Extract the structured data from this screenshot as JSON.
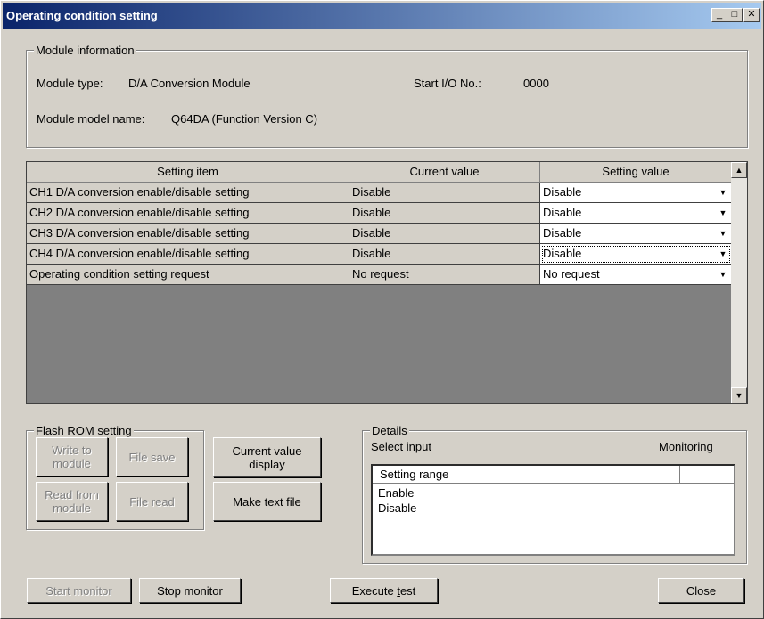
{
  "window": {
    "title": "Operating condition setting",
    "minimize": "_",
    "maximize": "□",
    "close": "✕"
  },
  "module_info": {
    "legend": "Module information",
    "type_label": "Module type:",
    "type_value": "D/A Conversion Module",
    "io_label": "Start I/O No.:",
    "io_value": "0000",
    "model_label": "Module model name:",
    "model_value": "Q64DA (Function Version C)"
  },
  "grid": {
    "headers": [
      "Setting item",
      "Current value",
      "Setting value"
    ],
    "rows": [
      {
        "item": "CH1 D/A conversion enable/disable setting",
        "current": "Disable",
        "setting": "Disable"
      },
      {
        "item": "CH2 D/A conversion enable/disable setting",
        "current": "Disable",
        "setting": "Disable"
      },
      {
        "item": "CH3 D/A conversion enable/disable setting",
        "current": "Disable",
        "setting": "Disable"
      },
      {
        "item": "CH4 D/A conversion enable/disable setting",
        "current": "Disable",
        "setting": "Disable"
      },
      {
        "item": "Operating condition setting request",
        "current": "No request",
        "setting": "No request"
      }
    ],
    "scroll_up": "▲",
    "scroll_down": "▼",
    "dropdown_arrow": "▼"
  },
  "flash_rom": {
    "legend": "Flash ROM setting",
    "write_to_module": "Write to\nmodule",
    "file_save": "File save",
    "read_from_module": "Read from\nmodule",
    "file_read": "File read"
  },
  "current_value_display": "Current value\ndisplay",
  "make_text_file": "Make text file",
  "details": {
    "legend": "Details",
    "select_input": "Select input",
    "monitoring": "Monitoring",
    "range_header": "Setting range",
    "range_items": [
      "Enable",
      "Disable"
    ]
  },
  "footer": {
    "start_monitor": "Start monitor",
    "stop_monitor": "Stop monitor",
    "execute_test_pre": "Execute ",
    "execute_test_mnemonic": "t",
    "execute_test_post": "est",
    "close": "Close"
  }
}
